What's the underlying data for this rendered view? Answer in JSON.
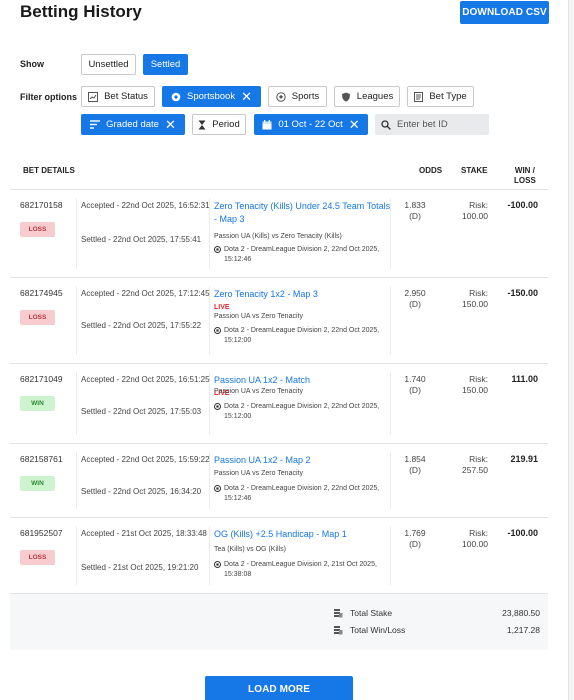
{
  "header": {
    "title": "Betting History",
    "download_label": "DOWNLOAD CSV"
  },
  "show": {
    "label": "Show",
    "options": [
      {
        "label": "Unsettled",
        "active": false
      },
      {
        "label": "Settled",
        "active": true
      }
    ]
  },
  "filters": {
    "label": "Filter options",
    "chips": [
      {
        "label": "Bet Status",
        "icon": "chart-icon",
        "active": false
      },
      {
        "label": "Sportsbook",
        "icon": "target-icon",
        "active": true
      },
      {
        "label": "Sports",
        "icon": "ball-icon",
        "active": false
      },
      {
        "label": "Leagues",
        "icon": "shield-icon",
        "active": false
      },
      {
        "label": "Bet Type",
        "icon": "document-icon",
        "active": false
      },
      {
        "label": "Graded date",
        "icon": "sort-icon",
        "active": true
      },
      {
        "label": "Period",
        "icon": "hourglass-icon",
        "active": false
      },
      {
        "label": "01 Oct - 22 Oct",
        "icon": "calendar-icon",
        "active": true
      }
    ],
    "search_placeholder": "Enter bet ID"
  },
  "table": {
    "headers": {
      "details": "BET DETAILS",
      "odds": "ODDS",
      "stake": "STAKE",
      "winloss_line1": "WIN /",
      "winloss_line2": "LOSS"
    },
    "rows": [
      {
        "id": "682170158",
        "status": "LOSS",
        "accepted": "Accepted - 22nd Oct 2025, 16:52:31",
        "settled": "Settled - 22nd Oct 2025, 17:55:41",
        "market": "Zero Tenacity (Kills) Under 24.5 Team Totals - Map 3",
        "live": "",
        "event": "Passion UA (Kills) vs Zero Tenacity (Kills)",
        "league": "Dota 2 - DreamLeague Division 2, 22nd Oct 2025, 15:12:46",
        "odds": "1.833",
        "odds_fmt": "(D)",
        "stake_label": "Risk:",
        "stake": "100.00",
        "result": "-100.00"
      },
      {
        "id": "682174945",
        "status": "LOSS",
        "accepted": "Accepted - 22nd Oct 2025, 17:12:45",
        "settled": "Settled - 22nd Oct 2025, 17:55:22",
        "market": "Zero Tenacity 1x2 - Map 3",
        "live": "LIVE",
        "event": "Passion UA vs Zero Tenacity",
        "league": "Dota 2 - DreamLeague Division 2, 22nd Oct 2025, 15:12:00",
        "odds": "2.950",
        "odds_fmt": "(D)",
        "stake_label": "Risk:",
        "stake": "150.00",
        "result": "-150.00"
      },
      {
        "id": "682171049",
        "status": "WIN",
        "accepted": "Accepted - 22nd Oct 2025, 16:51:25",
        "settled": "Settled - 22nd Oct 2025, 17:55:03",
        "market": "Passion UA 1x2 - Match",
        "live": "LIVE",
        "event": "Passion UA vs Zero Tenacity",
        "league": "Dota 2 - DreamLeague Division 2, 22nd Oct 2025, 15:12:00",
        "odds": "1.740",
        "odds_fmt": "(D)",
        "stake_label": "Risk:",
        "stake": "150.00",
        "result": "111.00"
      },
      {
        "id": "682158761",
        "status": "WIN",
        "accepted": "Accepted - 22nd Oct 2025, 15:59:22",
        "settled": "Settled - 22nd Oct 2025, 16:34:20",
        "market": "Passion UA 1x2 - Map 2",
        "live": "",
        "event": "Passion UA vs Zero Tenacity",
        "league": "Dota 2 - DreamLeague Division 2, 22nd Oct 2025, 15:12:46",
        "odds": "1.854",
        "odds_fmt": "(D)",
        "stake_label": "Risk:",
        "stake": "257.50",
        "result": "219.91"
      },
      {
        "id": "681952507",
        "status": "LOSS",
        "accepted": "Accepted - 21st Oct 2025, 18:33:48",
        "settled": "Settled - 21st Oct 2025, 19:21:20",
        "market": "OG (Kills) +2.5 Handicap - Map 1",
        "live": "",
        "event": "Tea (Kills) vs OG (Kills)",
        "league": "Dota 2 - DreamLeague Division 2, 21st Oct 2025, 15:38:08",
        "odds": "1.769",
        "odds_fmt": "(D)",
        "stake_label": "Risk:",
        "stake": "100.00",
        "result": "-100.00"
      }
    ]
  },
  "totals": {
    "stake_label": "Total Stake",
    "stake_value": "23,880.50",
    "winloss_label": "Total Win/Loss",
    "winloss_value": "1,217.28"
  },
  "footer": {
    "load_more_label": "LOAD MORE"
  },
  "colors": {
    "accent": "#1677e6",
    "live": "#e0262f",
    "loss_bg": "#f8cccf",
    "win_bg": "#cdf3cf"
  }
}
